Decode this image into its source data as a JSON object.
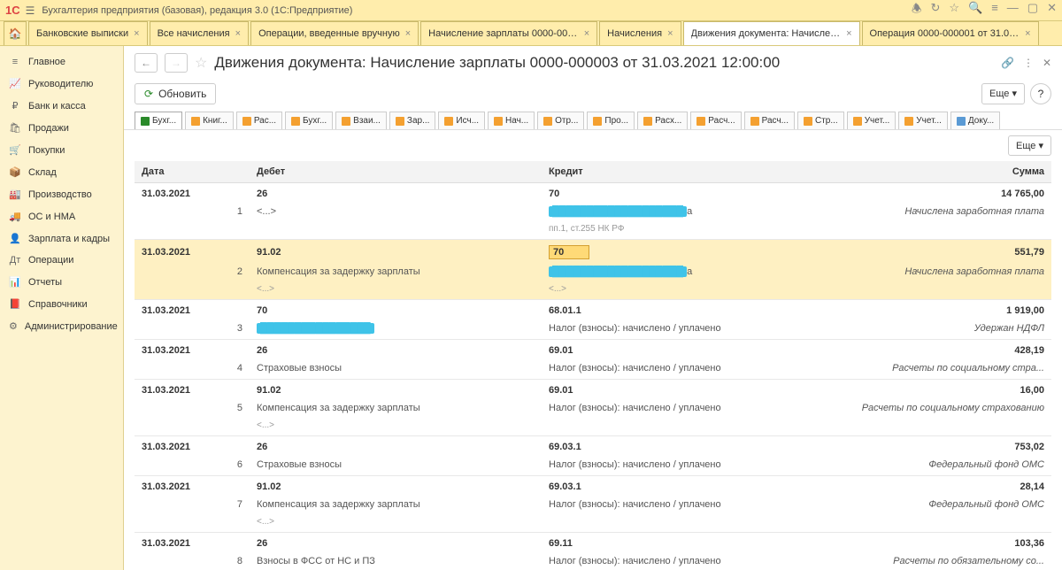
{
  "app": {
    "title": "Бухгалтерия предприятия (базовая), редакция 3.0  (1С:Предприятие)",
    "logo": "1C"
  },
  "tabs": [
    {
      "label": "Банковские выписки"
    },
    {
      "label": "Все начисления"
    },
    {
      "label": "Операции, введенные вручную"
    },
    {
      "label": "Начисление зарплаты 0000-000003 от 31..."
    },
    {
      "label": "Начисления"
    },
    {
      "label": "Движения документа: Начисление зарплат...",
      "active": true
    },
    {
      "label": "Операция 0000-000001 от 31.03.2021 18:..."
    }
  ],
  "sidebar": [
    {
      "icon": "≡",
      "label": "Главное"
    },
    {
      "icon": "📈",
      "label": "Руководителю"
    },
    {
      "icon": "₽",
      "label": "Банк и касса"
    },
    {
      "icon": "🛍",
      "label": "Продажи"
    },
    {
      "icon": "🛒",
      "label": "Покупки"
    },
    {
      "icon": "📦",
      "label": "Склад"
    },
    {
      "icon": "🏭",
      "label": "Производство"
    },
    {
      "icon": "🚚",
      "label": "ОС и НМА"
    },
    {
      "icon": "👤",
      "label": "Зарплата и кадры"
    },
    {
      "icon": "Дт",
      "label": "Операции"
    },
    {
      "icon": "📊",
      "label": "Отчеты"
    },
    {
      "icon": "📕",
      "label": "Справочники"
    },
    {
      "icon": "⚙",
      "label": "Администрирование"
    }
  ],
  "page": {
    "title": "Движения документа: Начисление зарплаты 0000-000003 от 31.03.2021 12:00:00",
    "refresh": "Обновить",
    "more": "Еще",
    "help": "?"
  },
  "subtabs": [
    "Бухг...",
    "Книг...",
    "Рас...",
    "Бухг...",
    "Взаи...",
    "Зар...",
    "Исч...",
    "Нач...",
    "Отр...",
    "Про...",
    "Расх...",
    "Расч...",
    "Расч...",
    "Стр...",
    "Учет...",
    "Учет...",
    "Доку..."
  ],
  "table": {
    "headers": {
      "date": "Дата",
      "debit": "Дебет",
      "credit": "Кредит",
      "sum": "Сумма"
    },
    "rows": [
      {
        "date": "31.03.2021",
        "num": "1",
        "debit": "26",
        "debit_sub": "<...>",
        "credit": "70",
        "credit_sub_redacted": true,
        "credit_sub2": "пп.1, ст.255 НК РФ",
        "sum": "14 765,00",
        "comment": "Начислена заработная плата"
      },
      {
        "date": "31.03.2021",
        "num": "2",
        "debit": "91.02",
        "debit_sub": "Компенсация за задержку зарплаты",
        "debit_sub2": "<...>",
        "credit": "70",
        "credit_hl": true,
        "credit_sub_redacted": true,
        "credit_sub2": "<...>",
        "sum": "551,79",
        "comment": "Начислена заработная плата",
        "highlighted": true
      },
      {
        "date": "31.03.2021",
        "num": "3",
        "debit": "70",
        "debit_sub_redacted": true,
        "credit": "68.01.1",
        "credit_sub": "Налог (взносы): начислено / уплачено",
        "sum": "1 919,00",
        "comment": "Удержан НДФЛ"
      },
      {
        "date": "31.03.2021",
        "num": "4",
        "debit": "26",
        "debit_sub": "Страховые взносы",
        "credit": "69.01",
        "credit_sub": "Налог (взносы): начислено / уплачено",
        "sum": "428,19",
        "comment": "Расчеты по социальному стра..."
      },
      {
        "date": "31.03.2021",
        "num": "5",
        "debit": "91.02",
        "debit_sub": "Компенсация за задержку зарплаты",
        "debit_sub2": "<...>",
        "credit": "69.01",
        "credit_sub": "Налог (взносы): начислено / уплачено",
        "sum": "16,00",
        "comment": "Расчеты по социальному страхованию"
      },
      {
        "date": "31.03.2021",
        "num": "6",
        "debit": "26",
        "debit_sub": "Страховые взносы",
        "credit": "69.03.1",
        "credit_sub": "Налог (взносы): начислено / уплачено",
        "sum": "753,02",
        "comment": "Федеральный фонд ОМС"
      },
      {
        "date": "31.03.2021",
        "num": "7",
        "debit": "91.02",
        "debit_sub": "Компенсация за задержку зарплаты",
        "debit_sub2": "<...>",
        "credit": "69.03.1",
        "credit_sub": "Налог (взносы): начислено / уплачено",
        "sum": "28,14",
        "comment": "Федеральный фонд ОМС"
      },
      {
        "date": "31.03.2021",
        "num": "8",
        "debit": "26",
        "debit_sub": "Взносы в ФСС от НС и ПЗ",
        "credit": "69.11",
        "credit_sub": "Налог (взносы): начислено / уплачено",
        "sum": "103,36",
        "comment": "Расчеты по обязательному со..."
      }
    ]
  }
}
